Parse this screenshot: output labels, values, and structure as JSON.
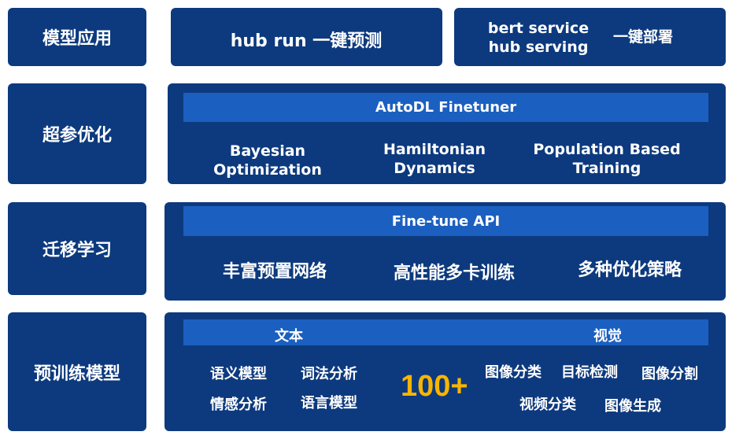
{
  "rows": {
    "app": {
      "label": "模型应用",
      "left_text": "hub run 一键预测",
      "right_line1": "bert service",
      "right_line2": "hub serving",
      "right_text": "一键部署"
    },
    "hpo": {
      "label": "超参优化",
      "bar": "AutoDL Finetuner",
      "items": [
        {
          "line1": "Bayesian",
          "line2": "Optimization"
        },
        {
          "line1": "Hamiltonian",
          "line2": "Dynamics"
        },
        {
          "line1": "Population Based",
          "line2": "Training"
        }
      ]
    },
    "transfer": {
      "label": "迁移学习",
      "bar": "Fine-tune API",
      "items": [
        "丰富预置网络",
        "高性能多卡训练",
        "多种优化策略"
      ]
    },
    "pretrain": {
      "label": "预训练模型",
      "bar_left": "文本",
      "bar_right": "视觉",
      "count": "100+",
      "text_models": [
        "语义模型",
        "词法分析",
        "情感分析",
        "语言模型"
      ],
      "vision_models": [
        "图像分类",
        "目标检测",
        "图像分割",
        "视频分类",
        "图像生成"
      ]
    }
  },
  "colors": {
    "box": "#0d3a7e",
    "bar": "#1b5fc0",
    "accent": "#f7b500"
  }
}
